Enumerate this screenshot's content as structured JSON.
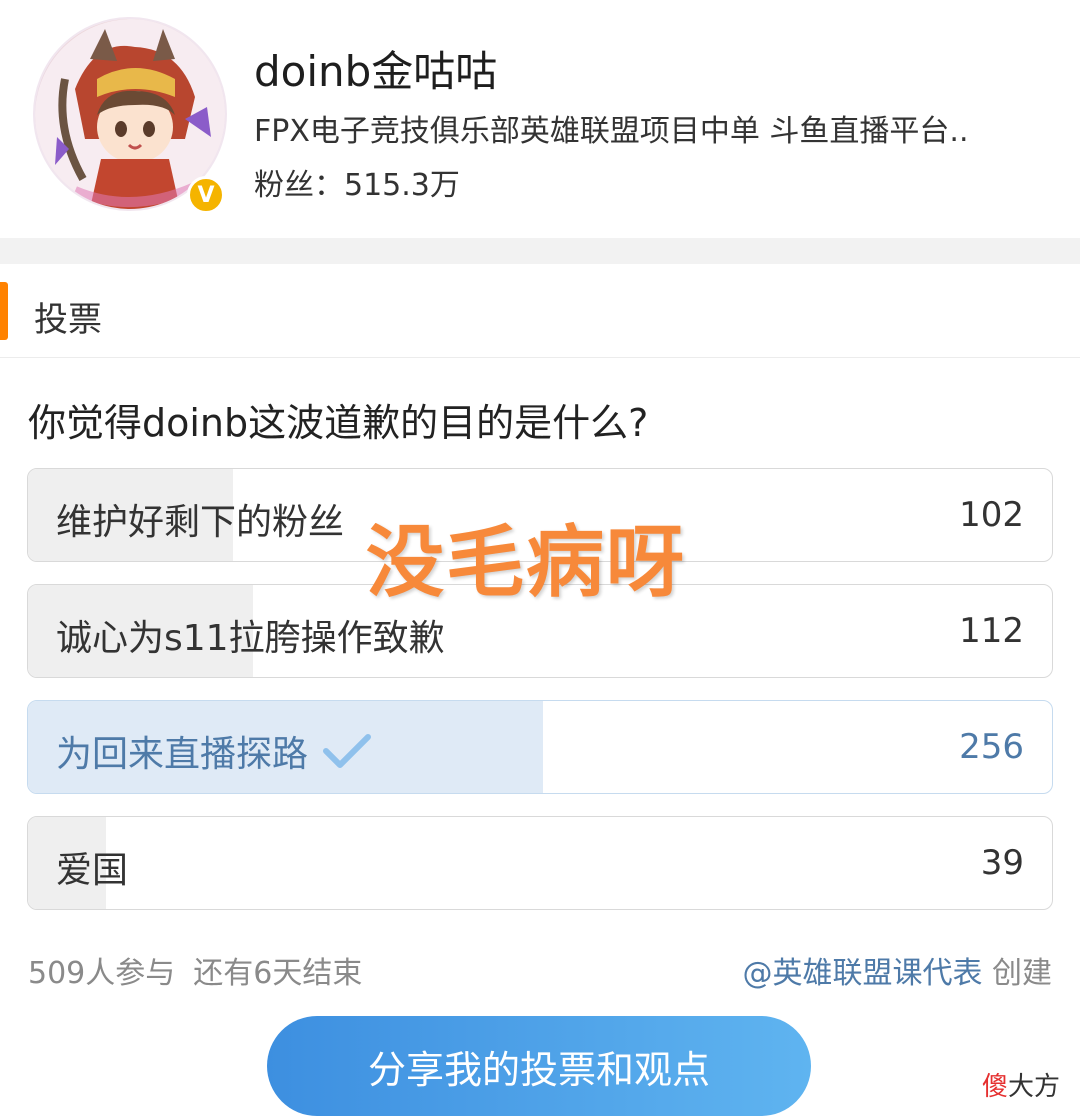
{
  "profile": {
    "name": "doinb金咕咕",
    "bio": "FPX电子竞技俱乐部英雄联盟项目中单 斗鱼直播平台..",
    "followers_label": "粉丝：515.3万",
    "verified_badge": "V",
    "avatar_icon": "avatar-illustration"
  },
  "section": {
    "title": "投票"
  },
  "poll": {
    "question": "你觉得doinb这波道歉的目的是什么?",
    "options": [
      {
        "label": "维护好剩下的粉丝",
        "count": "102",
        "votes": 102,
        "selected": false
      },
      {
        "label": "诚心为s11拉胯操作致歉",
        "count": "112",
        "votes": 112,
        "selected": false
      },
      {
        "label": "为回来直播探路",
        "count": "256",
        "votes": 256,
        "selected": true
      },
      {
        "label": "爱国",
        "count": "39",
        "votes": 39,
        "selected": false
      }
    ],
    "participants": "509人参与",
    "time_left": "还有6天结束",
    "creator": "@英雄联盟课代表",
    "creator_suffix": "创建",
    "share_label": "分享我的投票和观点"
  },
  "overlay": {
    "text": "没毛病呀"
  },
  "watermark": {
    "red": "傻",
    "rest": "大方"
  },
  "colors": {
    "accent_orange": "#ff8200",
    "selected_blue": "#4e7aa8",
    "selected_fill": "#dfeaf6",
    "fill_gray": "#efefef",
    "share_button": "#4a9fe8",
    "overlay_orange": "#f7893a"
  }
}
